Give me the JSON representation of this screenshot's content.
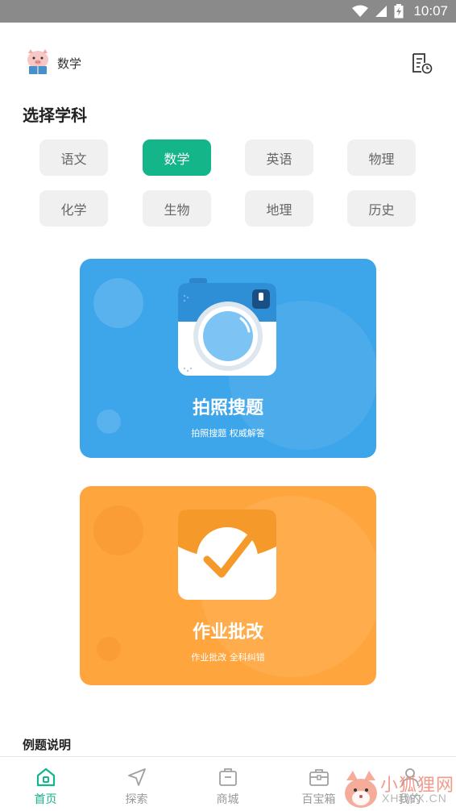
{
  "status_bar": {
    "time": "10:07",
    "icons": [
      "wifi-icon",
      "signal-icon",
      "battery-icon"
    ]
  },
  "header": {
    "subject": "数学",
    "avatar": "pig-avatar",
    "history_icon": "document-clock-icon"
  },
  "section": {
    "title": "选择学科"
  },
  "subjects": [
    {
      "label": "语文",
      "selected": false
    },
    {
      "label": "数学",
      "selected": true
    },
    {
      "label": "英语",
      "selected": false
    },
    {
      "label": "物理",
      "selected": false
    },
    {
      "label": "化学",
      "selected": false
    },
    {
      "label": "生物",
      "selected": false
    },
    {
      "label": "地理",
      "selected": false
    },
    {
      "label": "历史",
      "selected": false
    }
  ],
  "cards": {
    "photo_search": {
      "title": "拍照搜题",
      "subtitle": "拍照搜题 权威解答",
      "icon": "camera-icon",
      "color": "#3da5ea"
    },
    "homework_check": {
      "title": "作业批改",
      "subtitle": "作业批改 全科纠错",
      "icon": "checkmark-icon",
      "color": "#ffa53e"
    }
  },
  "example": {
    "title": "例题说明"
  },
  "nav": {
    "items": [
      {
        "label": "首页",
        "icon": "home-icon",
        "active": true
      },
      {
        "label": "探索",
        "icon": "navigation-icon",
        "active": false
      },
      {
        "label": "商城",
        "icon": "shop-icon",
        "active": false
      },
      {
        "label": "百宝箱",
        "icon": "toolbox-icon",
        "active": false
      },
      {
        "label": "我的",
        "icon": "user-icon",
        "active": false
      }
    ]
  },
  "watermark": {
    "text": "小狐狸网",
    "url": "XHLWX.CN"
  },
  "colors": {
    "accent": "#15b58a",
    "blue_card": "#3da5ea",
    "orange_card": "#ffa53e",
    "status_bar": "#8a8a8a"
  }
}
